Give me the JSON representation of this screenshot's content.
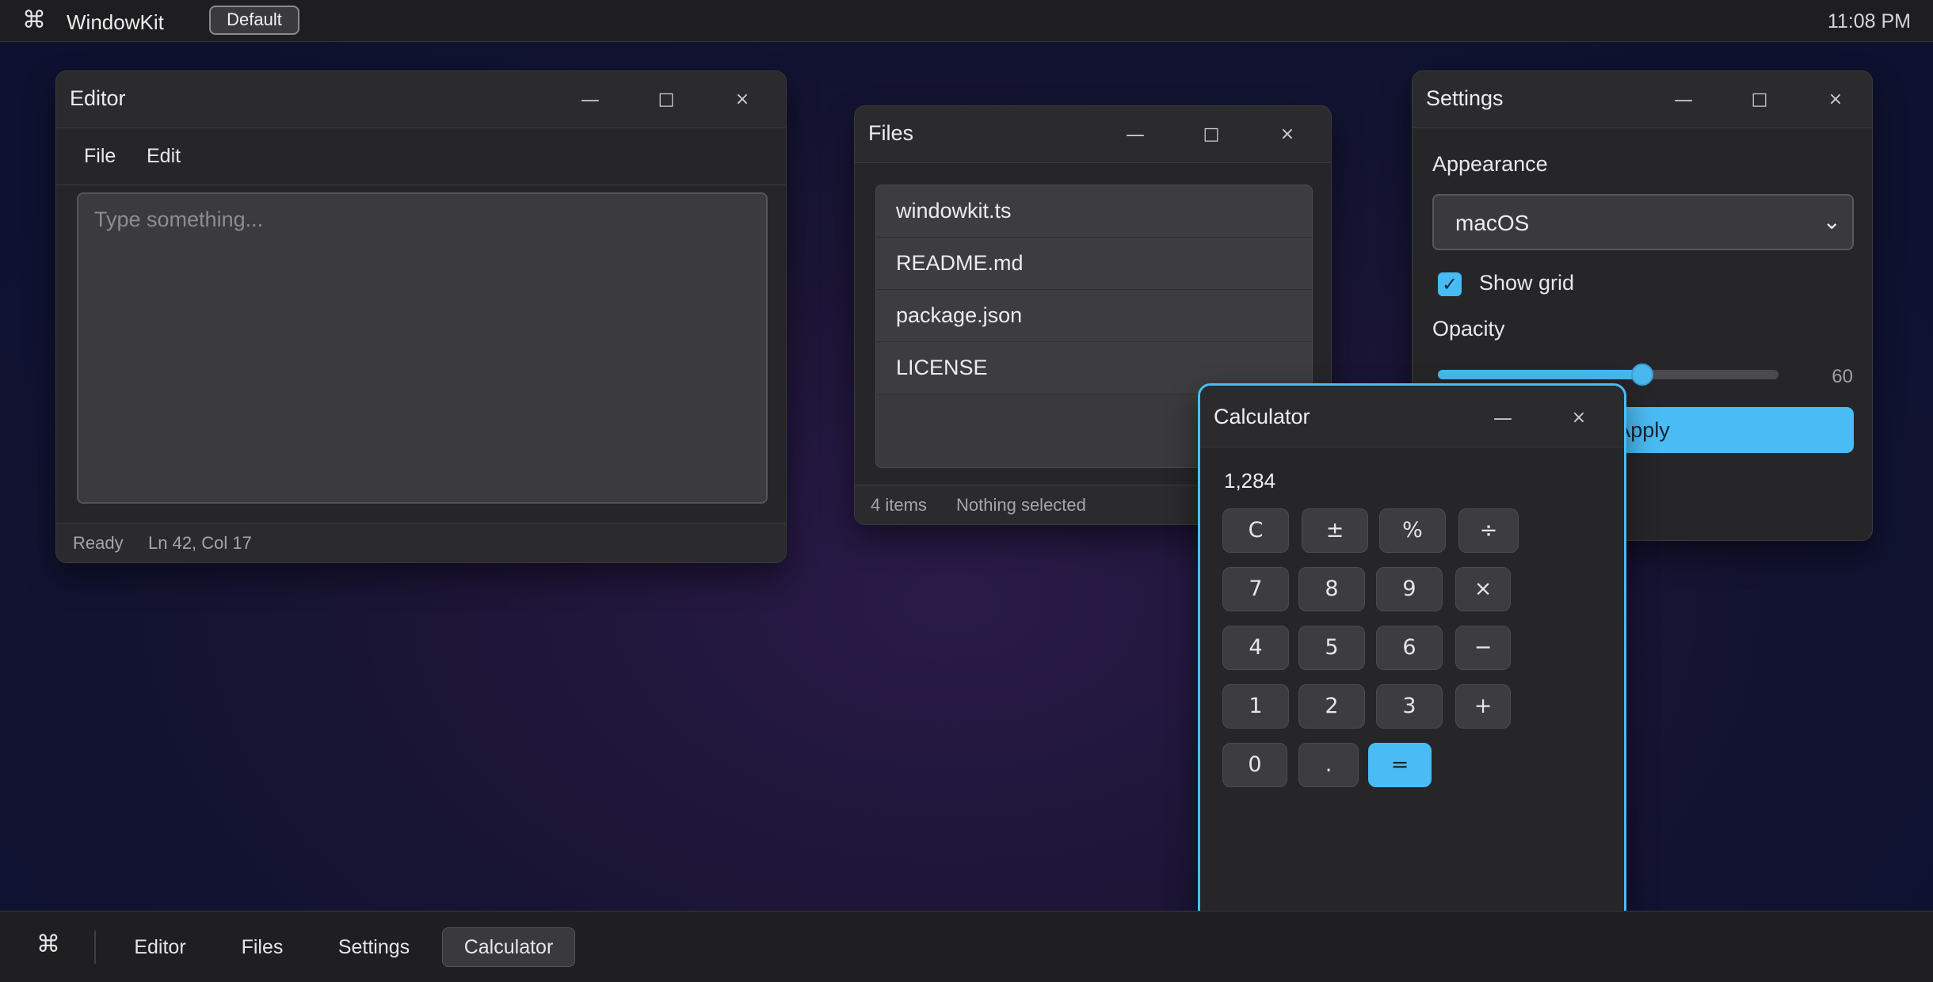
{
  "topbar": {
    "logo_glyph": "⌘",
    "app_name": "WindowKit",
    "theme_badge": "Default",
    "clock": "11:08 PM"
  },
  "editor": {
    "title": "Editor",
    "menu": [
      "File",
      "Edit"
    ],
    "placeholder": "Type something...",
    "status": "Ready",
    "cursor": "Ln 42, Col 17"
  },
  "files": {
    "title": "Files",
    "items": [
      "windowkit.ts",
      "README.md",
      "package.json",
      "LICENSE"
    ],
    "count": "4 items",
    "selection": "Nothing selected"
  },
  "settings": {
    "title": "Settings",
    "appearance_label": "Appearance",
    "appearance_value": "macOS",
    "show_grid_label": "Show grid",
    "show_grid_checked": true,
    "opacity_label": "Opacity",
    "opacity_value": "60",
    "opacity_fraction": 0.6,
    "apply_label": "Apply"
  },
  "calculator": {
    "title": "Calculator",
    "display": "1,284",
    "rows": [
      [
        "C",
        "±",
        "%",
        "÷"
      ],
      [
        "7",
        "8",
        "9",
        "×"
      ],
      [
        "4",
        "5",
        "6",
        "−"
      ],
      [
        "1",
        "2",
        "3",
        "+"
      ],
      [
        "0",
        ".",
        "="
      ]
    ]
  },
  "window_controls": {
    "minimize": "—",
    "maximize": "□",
    "close": "×"
  },
  "taskbar": {
    "logo_glyph": "⌘",
    "items": [
      "Editor",
      "Files",
      "Settings",
      "Calculator"
    ],
    "active": "Calculator"
  },
  "colors": {
    "accent": "#4abcf5",
    "window_bg": "#262628",
    "desktop": "#1c1536"
  }
}
